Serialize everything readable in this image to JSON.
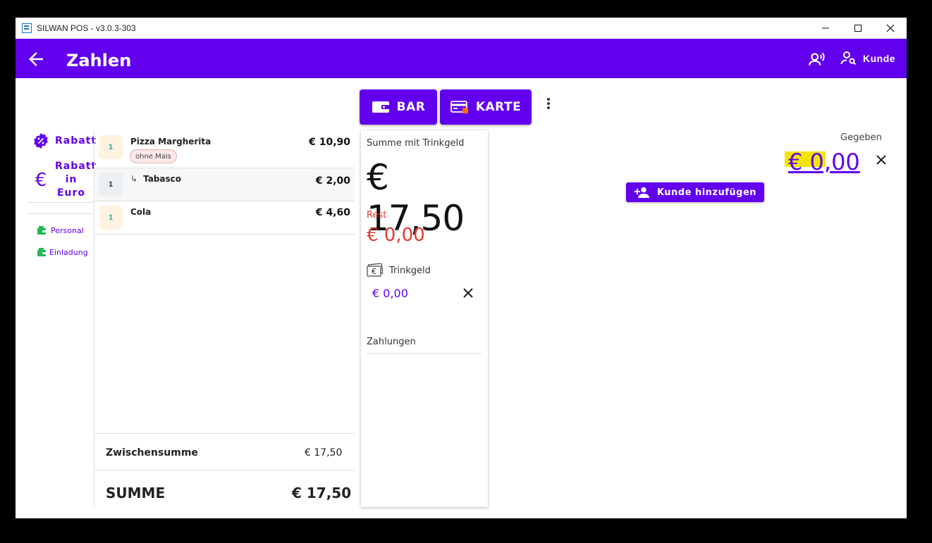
{
  "window": {
    "title": "SILWAN POS - v3.0.3-303"
  },
  "appbar": {
    "title": "Zahlen",
    "kunde_label": "Kunde"
  },
  "payment_buttons": {
    "bar": "BAR",
    "karte": "KARTE"
  },
  "sidebar": {
    "rabatt": "Rabatt",
    "rabatt_euro": "Rabatt in Euro",
    "personal": "Personal",
    "einladung": "Einladung"
  },
  "order": {
    "items": [
      {
        "qty": "1",
        "name": "Pizza Margherita",
        "price": "€ 10,90",
        "modifier": "ohne Mais"
      },
      {
        "qty": "1",
        "name": "Tabasco",
        "price": "€ 2,00",
        "sub_prefix": "↳"
      },
      {
        "qty": "1",
        "name": "Cola",
        "price": "€ 4,60"
      }
    ],
    "subtotal_label": "Zwischensumme",
    "subtotal_value": "€ 17,50",
    "total_label": "SUMME",
    "total_value": "€ 17,50"
  },
  "payment_card": {
    "sum_label": "Summe mit Trinkgeld",
    "sum_value": "€ 17,50",
    "rest_label": "Rest",
    "rest_value": "€ 0,00",
    "tip_label": "Trinkgeld",
    "tip_value": "€ 0,00",
    "payments_label": "Zahlungen"
  },
  "given": {
    "label": "Gegeben",
    "value": "€ 0,00"
  },
  "add_customer": {
    "label": "Kunde hinzufügen"
  },
  "colors": {
    "primary": "#6200ee",
    "rest": "#e53935",
    "highlight": "#f2e600",
    "personal": "#1db954"
  },
  "icons": [
    "back-arrow-icon",
    "speech-icon",
    "person-search-icon",
    "wallet-icon",
    "credit-card-icon",
    "more-vert-icon",
    "percent-badge-icon",
    "euro-icon",
    "wallet-small-icon",
    "close-icon",
    "money-icon",
    "person-add-icon"
  ]
}
